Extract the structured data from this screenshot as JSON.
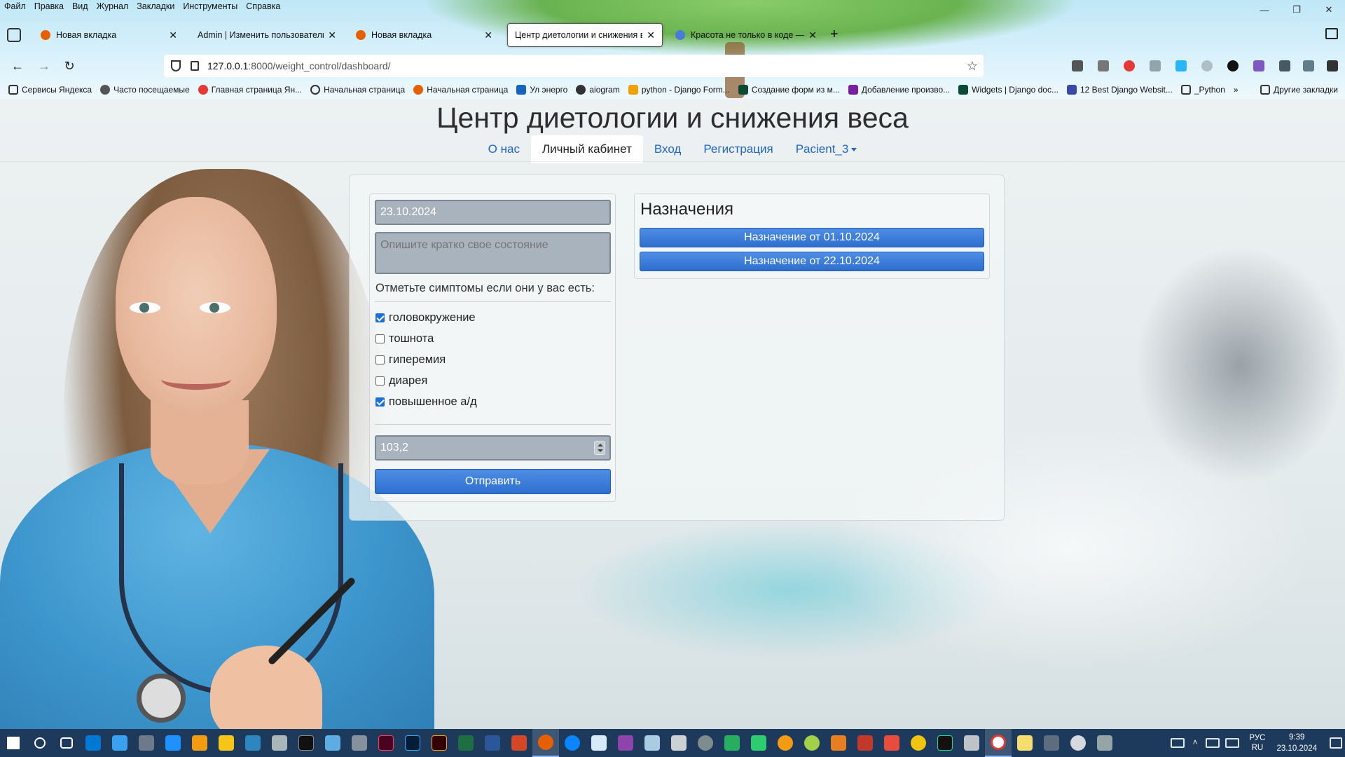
{
  "browser": {
    "menu": [
      "Файл",
      "Правка",
      "Вид",
      "Журнал",
      "Закладки",
      "Инструменты",
      "Справка"
    ],
    "tabs": [
      {
        "title": "Новая вкладка",
        "favicon_color": "#e66000"
      },
      {
        "title": "Admin | Изменить пользователь | A",
        "favicon_color": "#ffffff"
      },
      {
        "title": "Новая вкладка",
        "favicon_color": "#e66000"
      },
      {
        "title": "Центр диетологии и снижения веса",
        "favicon_color": "#ffffff"
      },
      {
        "title": "Красота не только в коде —",
        "favicon_color": "#4a7bd6"
      }
    ],
    "active_tab_index": 3,
    "url_host": "127.0.0.1",
    "url_path": ":8000/weight_control/dashboard/",
    "bookmarks": [
      "Сервисы Яндекса",
      "Часто посещаемые",
      "Главная страница Ян...",
      "Начальная страница",
      "Начальная страница",
      "Ул энерго",
      "aiogram",
      "python - Django Form...",
      "Создание форм из м...",
      "Добавление произво...",
      "Widgets | Django doc...",
      "12 Best Django Websit...",
      "_Python"
    ],
    "bookmarks_other": "Другие закладки"
  },
  "site": {
    "title": "Центр диетологии и снижения веса",
    "nav": {
      "about": "О нас",
      "cabinet": "Личный кабинет",
      "login": "Вход",
      "register": "Регистрация",
      "user": "Pacient_3"
    }
  },
  "form": {
    "date": "23.10.2024",
    "state_placeholder": "Опишите кратко свое состояние",
    "symptoms_label": "Отметьте симптомы если они у вас есть:",
    "symptoms": [
      {
        "label": "головокружение",
        "checked": true
      },
      {
        "label": "тошнота",
        "checked": false
      },
      {
        "label": "гиперемия",
        "checked": false
      },
      {
        "label": "диарея",
        "checked": false
      },
      {
        "label": "повышенное а/д",
        "checked": true
      }
    ],
    "weight": "103,2",
    "submit_label": "Отправить"
  },
  "appointments": {
    "title": "Назначения",
    "items": [
      "Назначение от 01.10.2024",
      "Назначение от 22.10.2024"
    ]
  },
  "taskbar": {
    "lang_top": "РУС",
    "lang_bottom": "RU",
    "time": "9:39",
    "date": "23.10.2024"
  }
}
